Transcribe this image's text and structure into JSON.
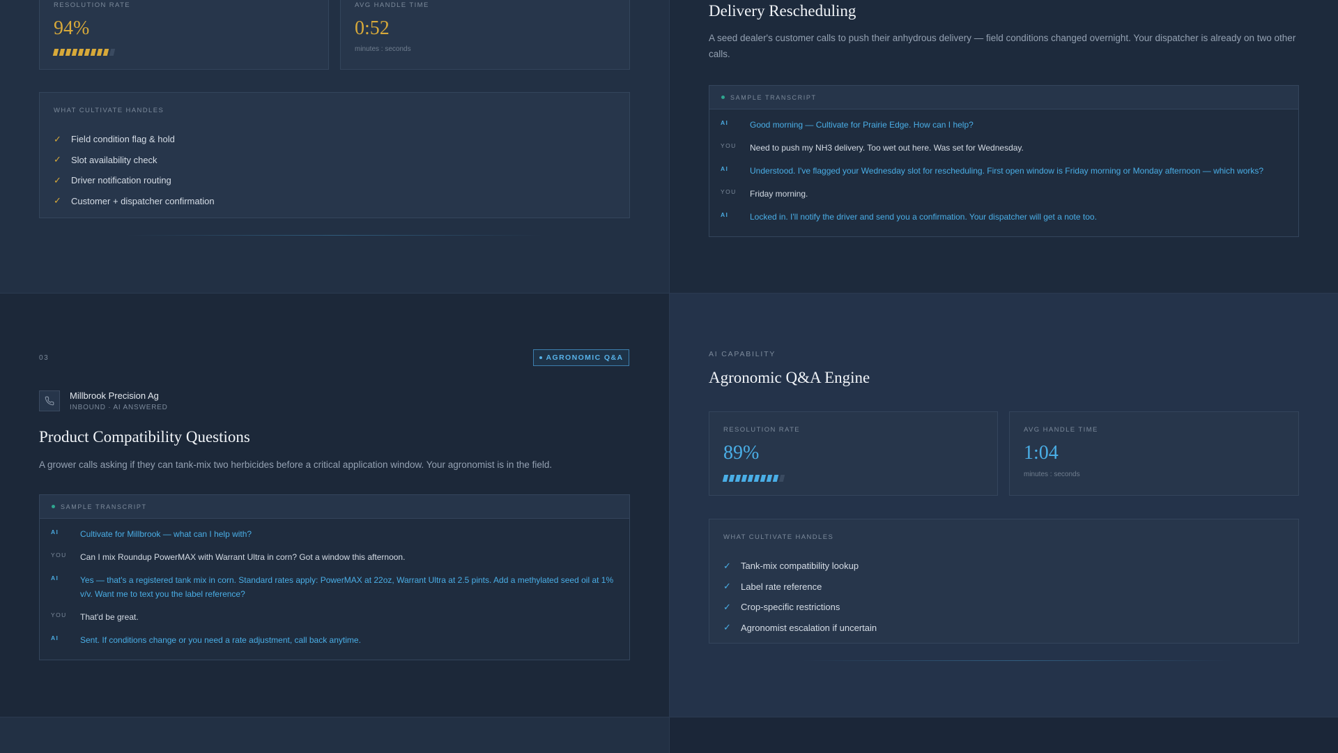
{
  "colors": {
    "gold": "#d7a93a",
    "blue": "#4aaee6",
    "teal": "#2fa58f"
  },
  "top_left": {
    "metrics": [
      {
        "label": "RESOLUTION RATE",
        "value": "94%",
        "progress_fraction": 0.94
      },
      {
        "label": "AVG HANDLE TIME",
        "value": "0:52",
        "sub": "minutes : seconds"
      }
    ],
    "handles_label": "WHAT CULTIVATE HANDLES",
    "handles": [
      "Field condition flag & hold",
      "Slot availability check",
      "Driver notification routing",
      "Customer + dispatcher confirmation"
    ]
  },
  "top_right": {
    "title": "Delivery Rescheduling",
    "description": "A seed dealer's customer calls to push their anhydrous delivery — field conditions changed overnight. Your dispatcher is already on two other calls.",
    "transcript_label": "SAMPLE TRANSCRIPT",
    "transcript": [
      {
        "speaker": "AI",
        "text": "Good morning — Cultivate for Prairie Edge. How can I help?"
      },
      {
        "speaker": "YOU",
        "text": "Need to push my NH3 delivery. Too wet out here. Was set for Wednesday."
      },
      {
        "speaker": "AI",
        "text": "Understood. I've flagged your Wednesday slot for rescheduling. First open window is Friday morning or Monday afternoon — which works?"
      },
      {
        "speaker": "YOU",
        "text": "Friday morning."
      },
      {
        "speaker": "AI",
        "text": "Locked in. I'll notify the driver and send you a confirmation. Your dispatcher will get a note too."
      }
    ]
  },
  "bottom_left": {
    "number": "03",
    "tag": "AGRONOMIC Q&A",
    "caller_icon": "phone-icon",
    "caller_name": "Millbrook Precision Ag",
    "caller_sub": "INBOUND · AI ANSWERED",
    "title": "Product Compatibility Questions",
    "description": "A grower calls asking if they can tank-mix two herbicides before a critical application window. Your agronomist is in the field.",
    "transcript_label": "SAMPLE TRANSCRIPT",
    "transcript": [
      {
        "speaker": "AI",
        "text": "Cultivate for Millbrook — what can I help with?"
      },
      {
        "speaker": "YOU",
        "text": "Can I mix Roundup PowerMAX with Warrant Ultra in corn? Got a window this afternoon."
      },
      {
        "speaker": "AI",
        "text": "Yes — that's a registered tank mix in corn. Standard rates apply: PowerMAX at 22oz, Warrant Ultra at 2.5 pints. Add a methylated seed oil at 1% v/v. Want me to text you the label reference?"
      },
      {
        "speaker": "YOU",
        "text": "That'd be great."
      },
      {
        "speaker": "AI",
        "text": "Sent. If conditions change or you need a rate adjustment, call back anytime."
      }
    ]
  },
  "bottom_right": {
    "capability_label": "AI CAPABILITY",
    "title": "Agronomic Q&A Engine",
    "metrics": [
      {
        "label": "RESOLUTION RATE",
        "value": "89%",
        "progress_fraction": 0.89
      },
      {
        "label": "AVG HANDLE TIME",
        "value": "1:04",
        "sub": "minutes : seconds"
      }
    ],
    "handles_label": "WHAT CULTIVATE HANDLES",
    "handles": [
      "Tank-mix compatibility lookup",
      "Label rate reference",
      "Crop-specific restrictions",
      "Agronomist escalation if uncertain"
    ]
  }
}
